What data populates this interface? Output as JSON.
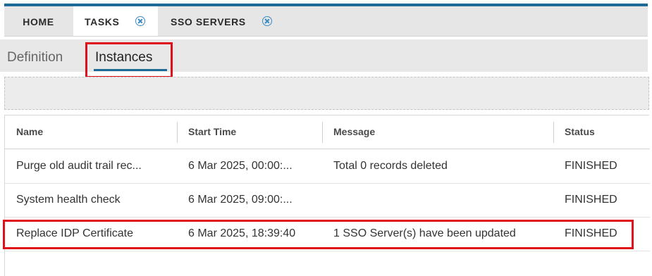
{
  "tabs": [
    {
      "label": "HOME",
      "active": false,
      "closable": false
    },
    {
      "label": "TASKS",
      "active": true,
      "closable": true
    },
    {
      "label": "SSO SERVERS",
      "active": false,
      "closable": true
    }
  ],
  "subtabs": [
    {
      "label": "Definition",
      "active": false
    },
    {
      "label": "Instances",
      "active": true
    }
  ],
  "table": {
    "columns": [
      "Name",
      "Start Time",
      "Message",
      "Status"
    ],
    "rows": [
      {
        "name": "Purge old audit trail rec...",
        "start_time": "6 Mar 2025, 00:00:...",
        "message": "Total 0 records deleted",
        "status": "FINISHED"
      },
      {
        "name": "System health check",
        "start_time": "6 Mar 2025, 09:00:...",
        "message": "",
        "status": "FINISHED"
      },
      {
        "name": "Replace IDP Certificate",
        "start_time": "6 Mar 2025, 18:39:40",
        "message": "1 SSO Server(s) have been updated",
        "status": "FINISHED"
      }
    ]
  },
  "colors": {
    "accent": "#1d6a96",
    "close_icon": "#3a8ac4",
    "highlight": "#e0101a"
  },
  "icons": {
    "tab_close": "close-circle-icon"
  }
}
